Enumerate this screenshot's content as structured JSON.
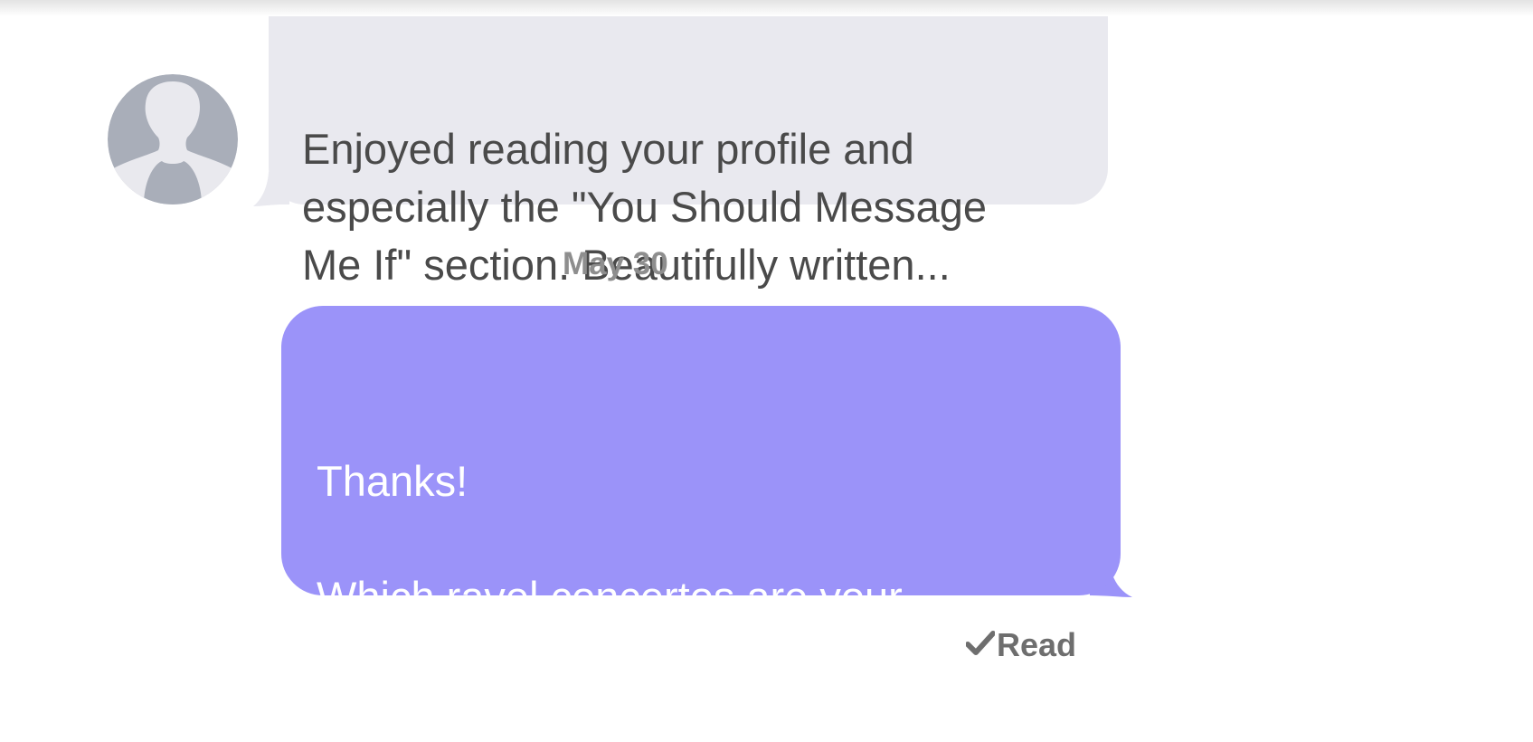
{
  "conversation": {
    "received_message": {
      "text": "Enjoyed reading your profile and\nespecially the \"You Should Message\nMe If\" section. Beautifully written..."
    },
    "date_separator": "May 30",
    "sent_message": {
      "text": "Thanks!\n\nWhich ravel concertos are your\nfave(s)?"
    },
    "read_receipt": "Read"
  },
  "icons": {
    "avatar": "default-user-silhouette-icon",
    "read": "checkmark-icon"
  },
  "colors": {
    "received_bubble": "#e9e9ef",
    "sent_bubble": "#9b93f9",
    "avatar_bg": "#e9e9ee",
    "avatar_silhouette": "#a9aeb9"
  }
}
